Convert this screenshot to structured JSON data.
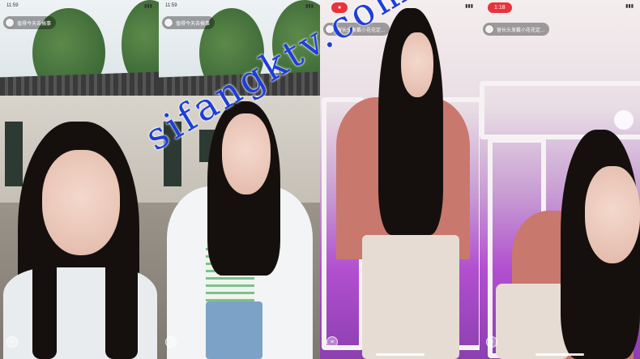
{
  "panels": [
    {
      "time": "11:59",
      "chip_label": "值得今天去搞事",
      "recording": ""
    },
    {
      "time": "11:59",
      "chip_label": "值得今天去搞事",
      "recording": ""
    },
    {
      "time": "",
      "chip_label": "留长头发戴小花花定...",
      "recording": "●"
    },
    {
      "time": "",
      "chip_label": "留长头发戴小花花定...",
      "recording": "1:18"
    }
  ],
  "watermark": "sifangktv.com",
  "icons": {
    "comment": "comment-icon",
    "avatar": "avatar-icon",
    "record": "record-icon",
    "battery": "battery-icon"
  },
  "colors": {
    "watermark": "#1e3fd6",
    "record": "#e8333c",
    "purple_light": "#b24fd0"
  }
}
